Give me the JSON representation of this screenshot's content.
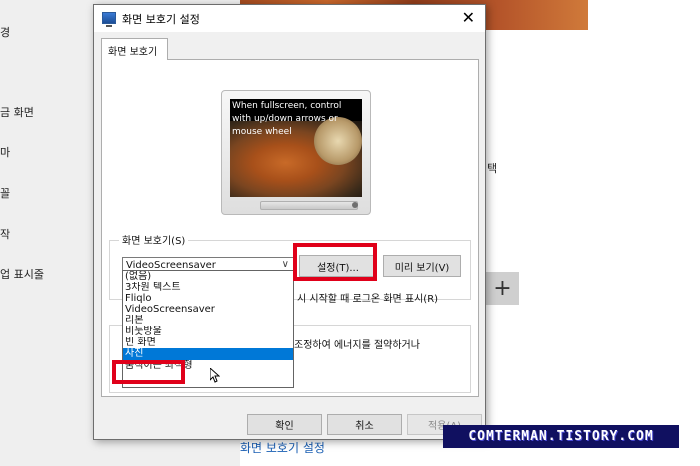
{
  "background": {
    "sidebar_items": [
      "경",
      "금 화면",
      "마",
      "꼴",
      "작",
      "업 표시줄"
    ],
    "right_text": "택",
    "plus_label": "+",
    "link": "화면 보호기 설정"
  },
  "dialog": {
    "title": "화면 보호기 설정",
    "close_glyph": "✕",
    "tab_label": "화면 보호기",
    "preview_text": "When fullscreen, control with up/down arrows or mouse wheel",
    "screensaver_group_label": "화면 보호기(S)",
    "selected_value": "VideoScreensaver",
    "settings_button": "설정(T)...",
    "preview_button": "미리 보기(V)",
    "wait_text": "시 시작할 때 로그온 화면 표시(R)",
    "power_text": "조정하여 에너지를 절약하거나",
    "dropdown_options": [
      "(없음)",
      "3차원 텍스트",
      "Fliqlo",
      "VideoScreensaver",
      "리본",
      "비눗방울",
      "빈 화면",
      "사진",
      "움직이는 좌석형"
    ],
    "selected_option_index": 7,
    "ok_button": "확인",
    "cancel_button": "취소",
    "apply_button": "적용(A)"
  },
  "watermark": "COMTERMAN.TISTORY.COM",
  "colors": {
    "highlight": "#e0001a",
    "selection": "#0078d7",
    "watermark_bg": "#101060"
  }
}
